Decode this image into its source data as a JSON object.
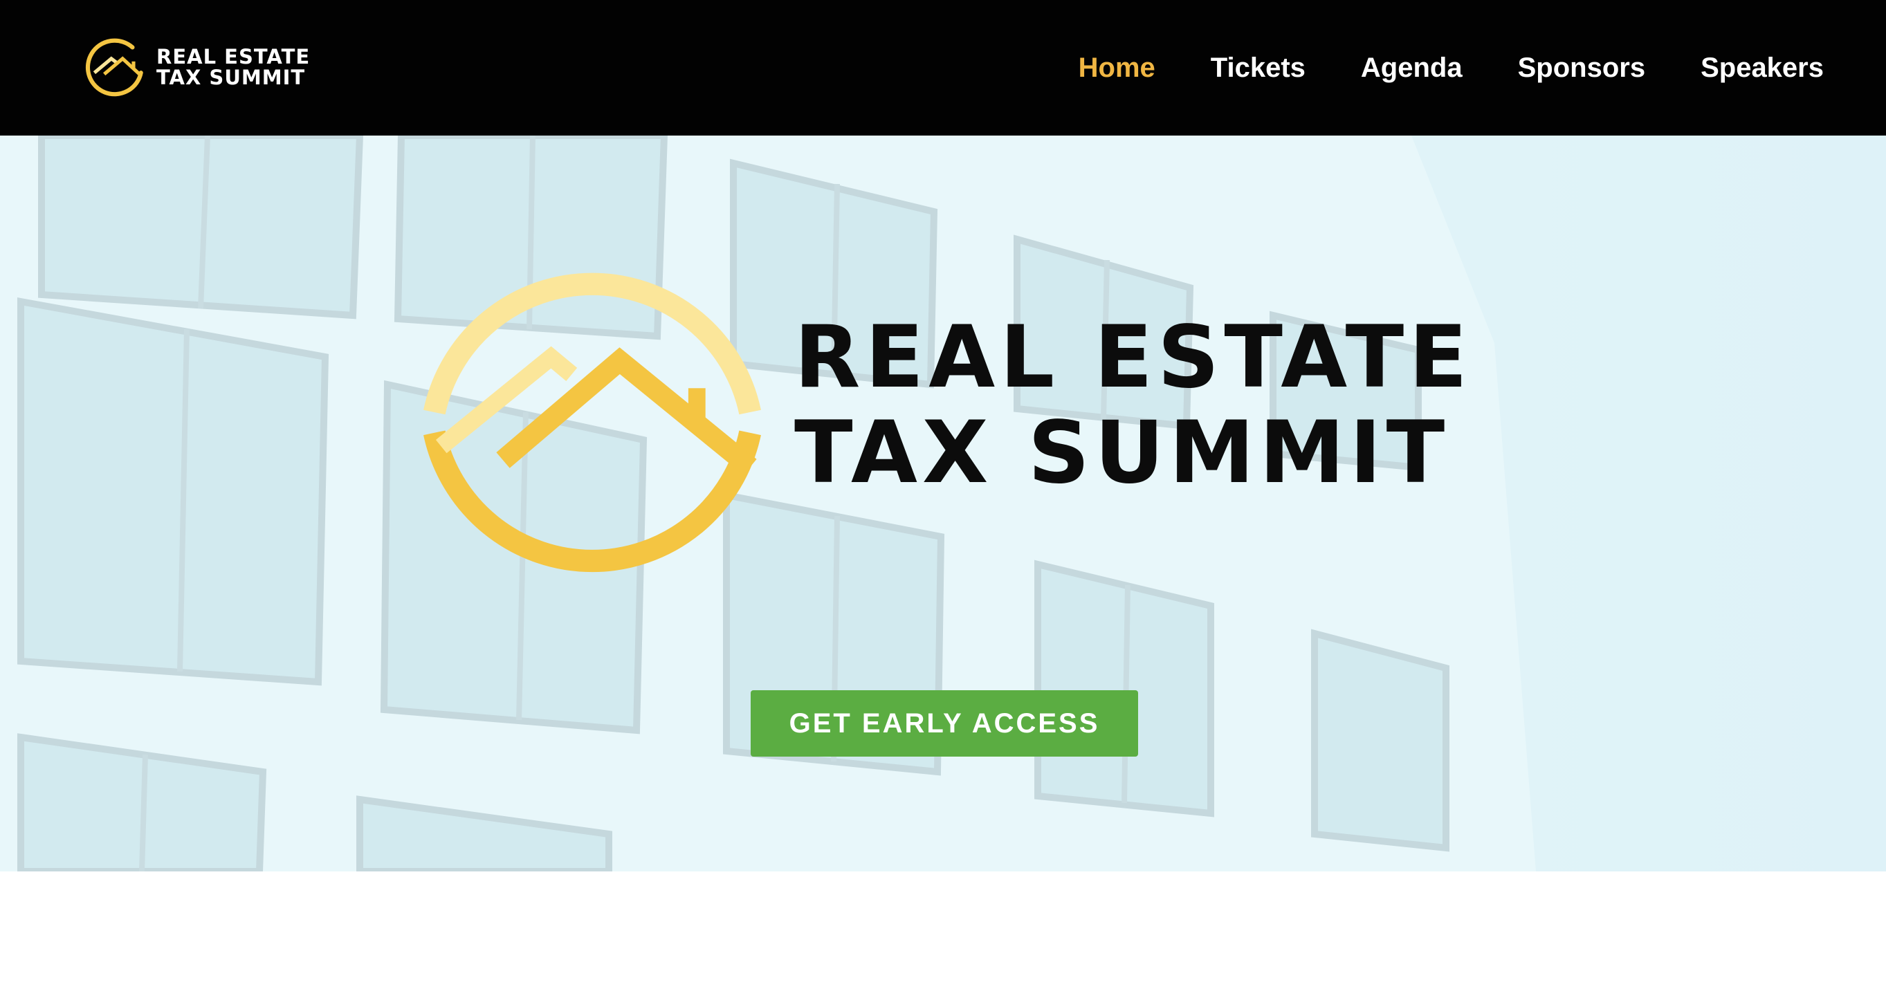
{
  "header": {
    "logo": {
      "line1": "REAL ESTATE",
      "line2": "TAX SUMMIT",
      "icon": "house-circle-logo-icon"
    },
    "nav": [
      {
        "label": "Home",
        "active": true
      },
      {
        "label": "Tickets",
        "active": false
      },
      {
        "label": "Agenda",
        "active": false
      },
      {
        "label": "Sponsors",
        "active": false
      },
      {
        "label": "Speakers",
        "active": false
      }
    ]
  },
  "hero": {
    "title_line1": "REAL ESTATE",
    "title_line2": "TAX SUMMIT",
    "cta_label": "GET EARLY ACCESS",
    "background": "building-windows-photo"
  },
  "colors": {
    "header_bg": "#020202",
    "nav_text": "#ffffff",
    "nav_active": "#f0b643",
    "logo_gold": "#f4c542",
    "logo_gold_light": "#fbe69a",
    "cta_bg": "#5bad42",
    "hero_tint": "#dcf1f7"
  }
}
